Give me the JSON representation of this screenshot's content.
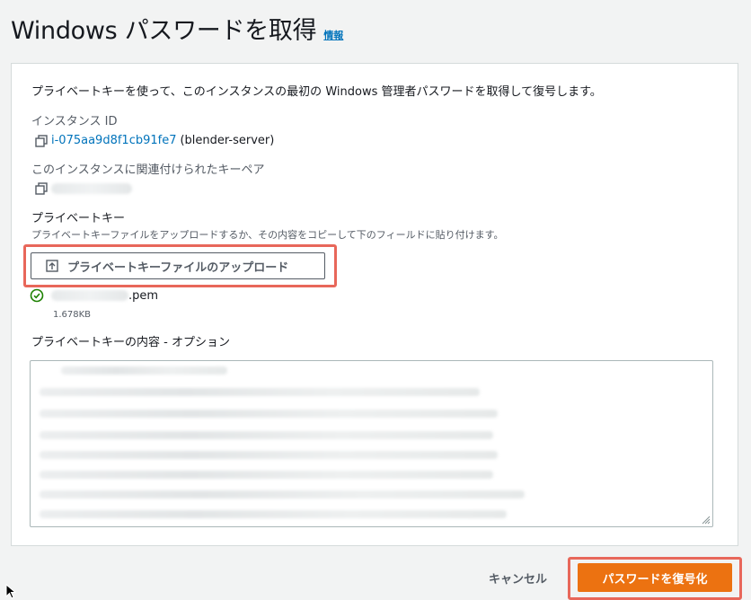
{
  "header": {
    "title": "Windows パスワードを取得",
    "info_link": "情報"
  },
  "form": {
    "description": "プライベートキーを使って、このインスタンスの最初の Windows 管理者パスワードを取得して復号します。",
    "instance_id_label": "インスタンス ID",
    "instance_id": "i-075aa9d8f1cb91fe7",
    "instance_name": "(blender-server)",
    "keypair_label": "このインスタンスに関連付けられたキーペア",
    "private_key_label": "プライベートキー",
    "private_key_hint": "プライベートキーファイルをアップロードするか、その内容をコピーして下のフィールドに貼り付けます。",
    "upload_button": "プライベートキーファイルのアップロード",
    "file_ext": ".pem",
    "file_size": "1.678KB",
    "contents_label": "プライベートキーの内容 - オプション"
  },
  "footer": {
    "cancel": "キャンセル",
    "submit": "パスワードを復号化"
  },
  "colors": {
    "link": "#0073bb",
    "primary": "#ec7211",
    "success": "#1d8102",
    "highlight": "#e8675a"
  },
  "icons": [
    "copy-icon",
    "upload-icon",
    "check-circle-icon",
    "resize-grip-icon",
    "mouse-pointer-icon"
  ]
}
